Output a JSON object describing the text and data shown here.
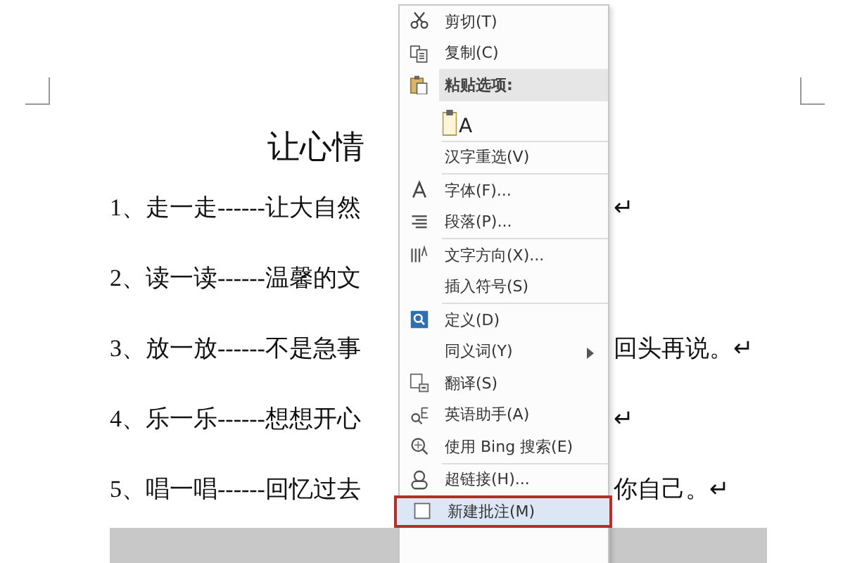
{
  "document": {
    "title": "让心情",
    "lines": [
      {
        "left": "1、走一走------让大自然",
        "right": "↵",
        "highlighted": false
      },
      {
        "left": "2、读一读------温馨的文",
        "highlighted": false
      },
      {
        "left": "3、放一放------不是急事",
        "right": "回头再说。↵",
        "highlighted": false
      },
      {
        "left": "4、乐一乐------想想开心",
        "right": "↵",
        "highlighted": false
      },
      {
        "left": "5、唱一唱------回忆过去",
        "right": "你自己。↵",
        "highlighted": false
      },
      {
        "highlighted": true
      }
    ]
  },
  "context_menu": {
    "items": [
      {
        "kind": "item",
        "label": "剪切(T)",
        "submenu": false,
        "selected": false
      },
      {
        "kind": "item",
        "label": "复制(C)",
        "submenu": false,
        "selected": false
      },
      {
        "kind": "header",
        "label": "粘贴选项:"
      },
      {
        "kind": "paste",
        "label": "A"
      },
      {
        "kind": "separator"
      },
      {
        "kind": "item",
        "label": "汉字重选(V)",
        "submenu": false,
        "selected": false
      },
      {
        "kind": "separator"
      },
      {
        "kind": "item",
        "label": "字体(F)...",
        "submenu": false,
        "selected": false
      },
      {
        "kind": "item",
        "label": "段落(P)...",
        "submenu": false,
        "selected": false
      },
      {
        "kind": "separator"
      },
      {
        "kind": "item",
        "label": "文字方向(X)...",
        "submenu": false,
        "selected": false
      },
      {
        "kind": "item",
        "label": "插入符号(S)",
        "submenu": false,
        "selected": false
      },
      {
        "kind": "separator"
      },
      {
        "kind": "item",
        "label": "定义(D)",
        "submenu": false,
        "selected": false
      },
      {
        "kind": "item",
        "label": "同义词(Y)",
        "submenu": true,
        "selected": false
      },
      {
        "kind": "item",
        "label": "翻译(S)",
        "submenu": false,
        "selected": false
      },
      {
        "kind": "item",
        "label": "英语助手(A)",
        "submenu": false,
        "selected": false
      },
      {
        "kind": "item",
        "label": "使用 Bing 搜索(E)",
        "submenu": false,
        "selected": false
      },
      {
        "kind": "separator"
      },
      {
        "kind": "item",
        "label": "超链接(H)...",
        "submenu": false,
        "selected": false
      },
      {
        "kind": "item",
        "label": "新建批注(M)",
        "submenu": false,
        "selected": true
      }
    ]
  }
}
